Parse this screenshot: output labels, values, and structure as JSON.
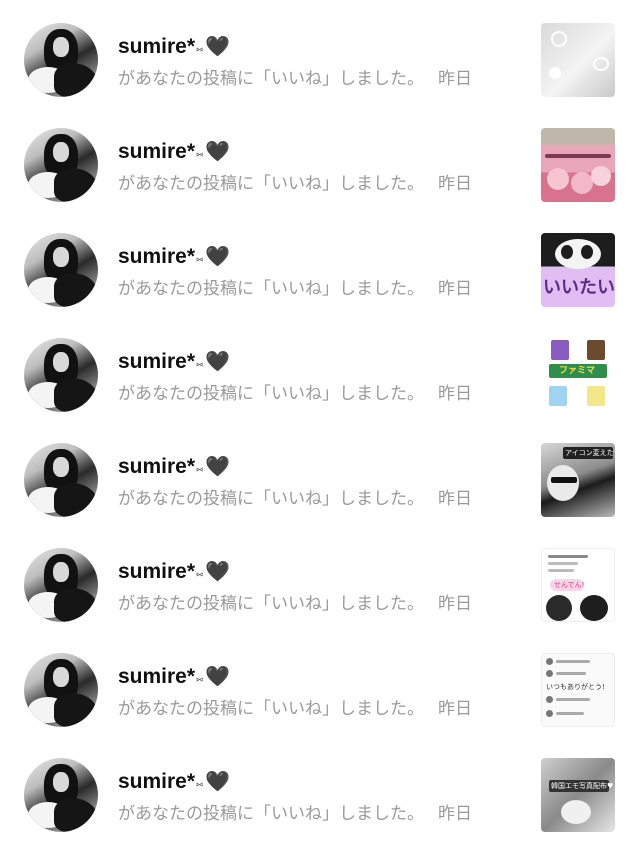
{
  "notifications": [
    {
      "username": "sumire*",
      "deco": "⑅",
      "heart": "🖤",
      "message": "があなたの投稿に「いいね」しました。",
      "time": "昨日",
      "thumb_text": ""
    },
    {
      "username": "sumire*",
      "deco": "⑅",
      "heart": "🖤",
      "message": "があなたの投稿に「いいね」しました。",
      "time": "昨日",
      "thumb_text": ""
    },
    {
      "username": "sumire*",
      "deco": "⑅",
      "heart": "🖤",
      "message": "があなたの投稿に「いいね」しました。",
      "time": "昨日",
      "thumb_text": "いいたい"
    },
    {
      "username": "sumire*",
      "deco": "⑅",
      "heart": "🖤",
      "message": "があなたの投稿に「いいね」しました。",
      "time": "昨日",
      "thumb_text": "ファミマ"
    },
    {
      "username": "sumire*",
      "deco": "⑅",
      "heart": "🖤",
      "message": "があなたの投稿に「いいね」しました。",
      "time": "昨日",
      "thumb_text": "アイコン変えた♡"
    },
    {
      "username": "sumire*",
      "deco": "⑅",
      "heart": "🖤",
      "message": "があなたの投稿に「いいね」しました。",
      "time": "昨日",
      "thumb_text": "せんでん!"
    },
    {
      "username": "sumire*",
      "deco": "⑅",
      "heart": "🖤",
      "message": "があなたの投稿に「いいね」しました。",
      "time": "昨日",
      "thumb_text": "いつもありがとう!"
    },
    {
      "username": "sumire*",
      "deco": "⑅",
      "heart": "🖤",
      "message": "があなたの投稿に「いいね」しました。",
      "time": "昨日",
      "thumb_text": "韓国エモ写真配布♥"
    }
  ],
  "colors": {
    "username": "#111111",
    "message": "#9a9a9a",
    "background": "#ffffff"
  },
  "icons": {
    "avatar": "user-avatar",
    "thumb": "post-thumbnail"
  }
}
